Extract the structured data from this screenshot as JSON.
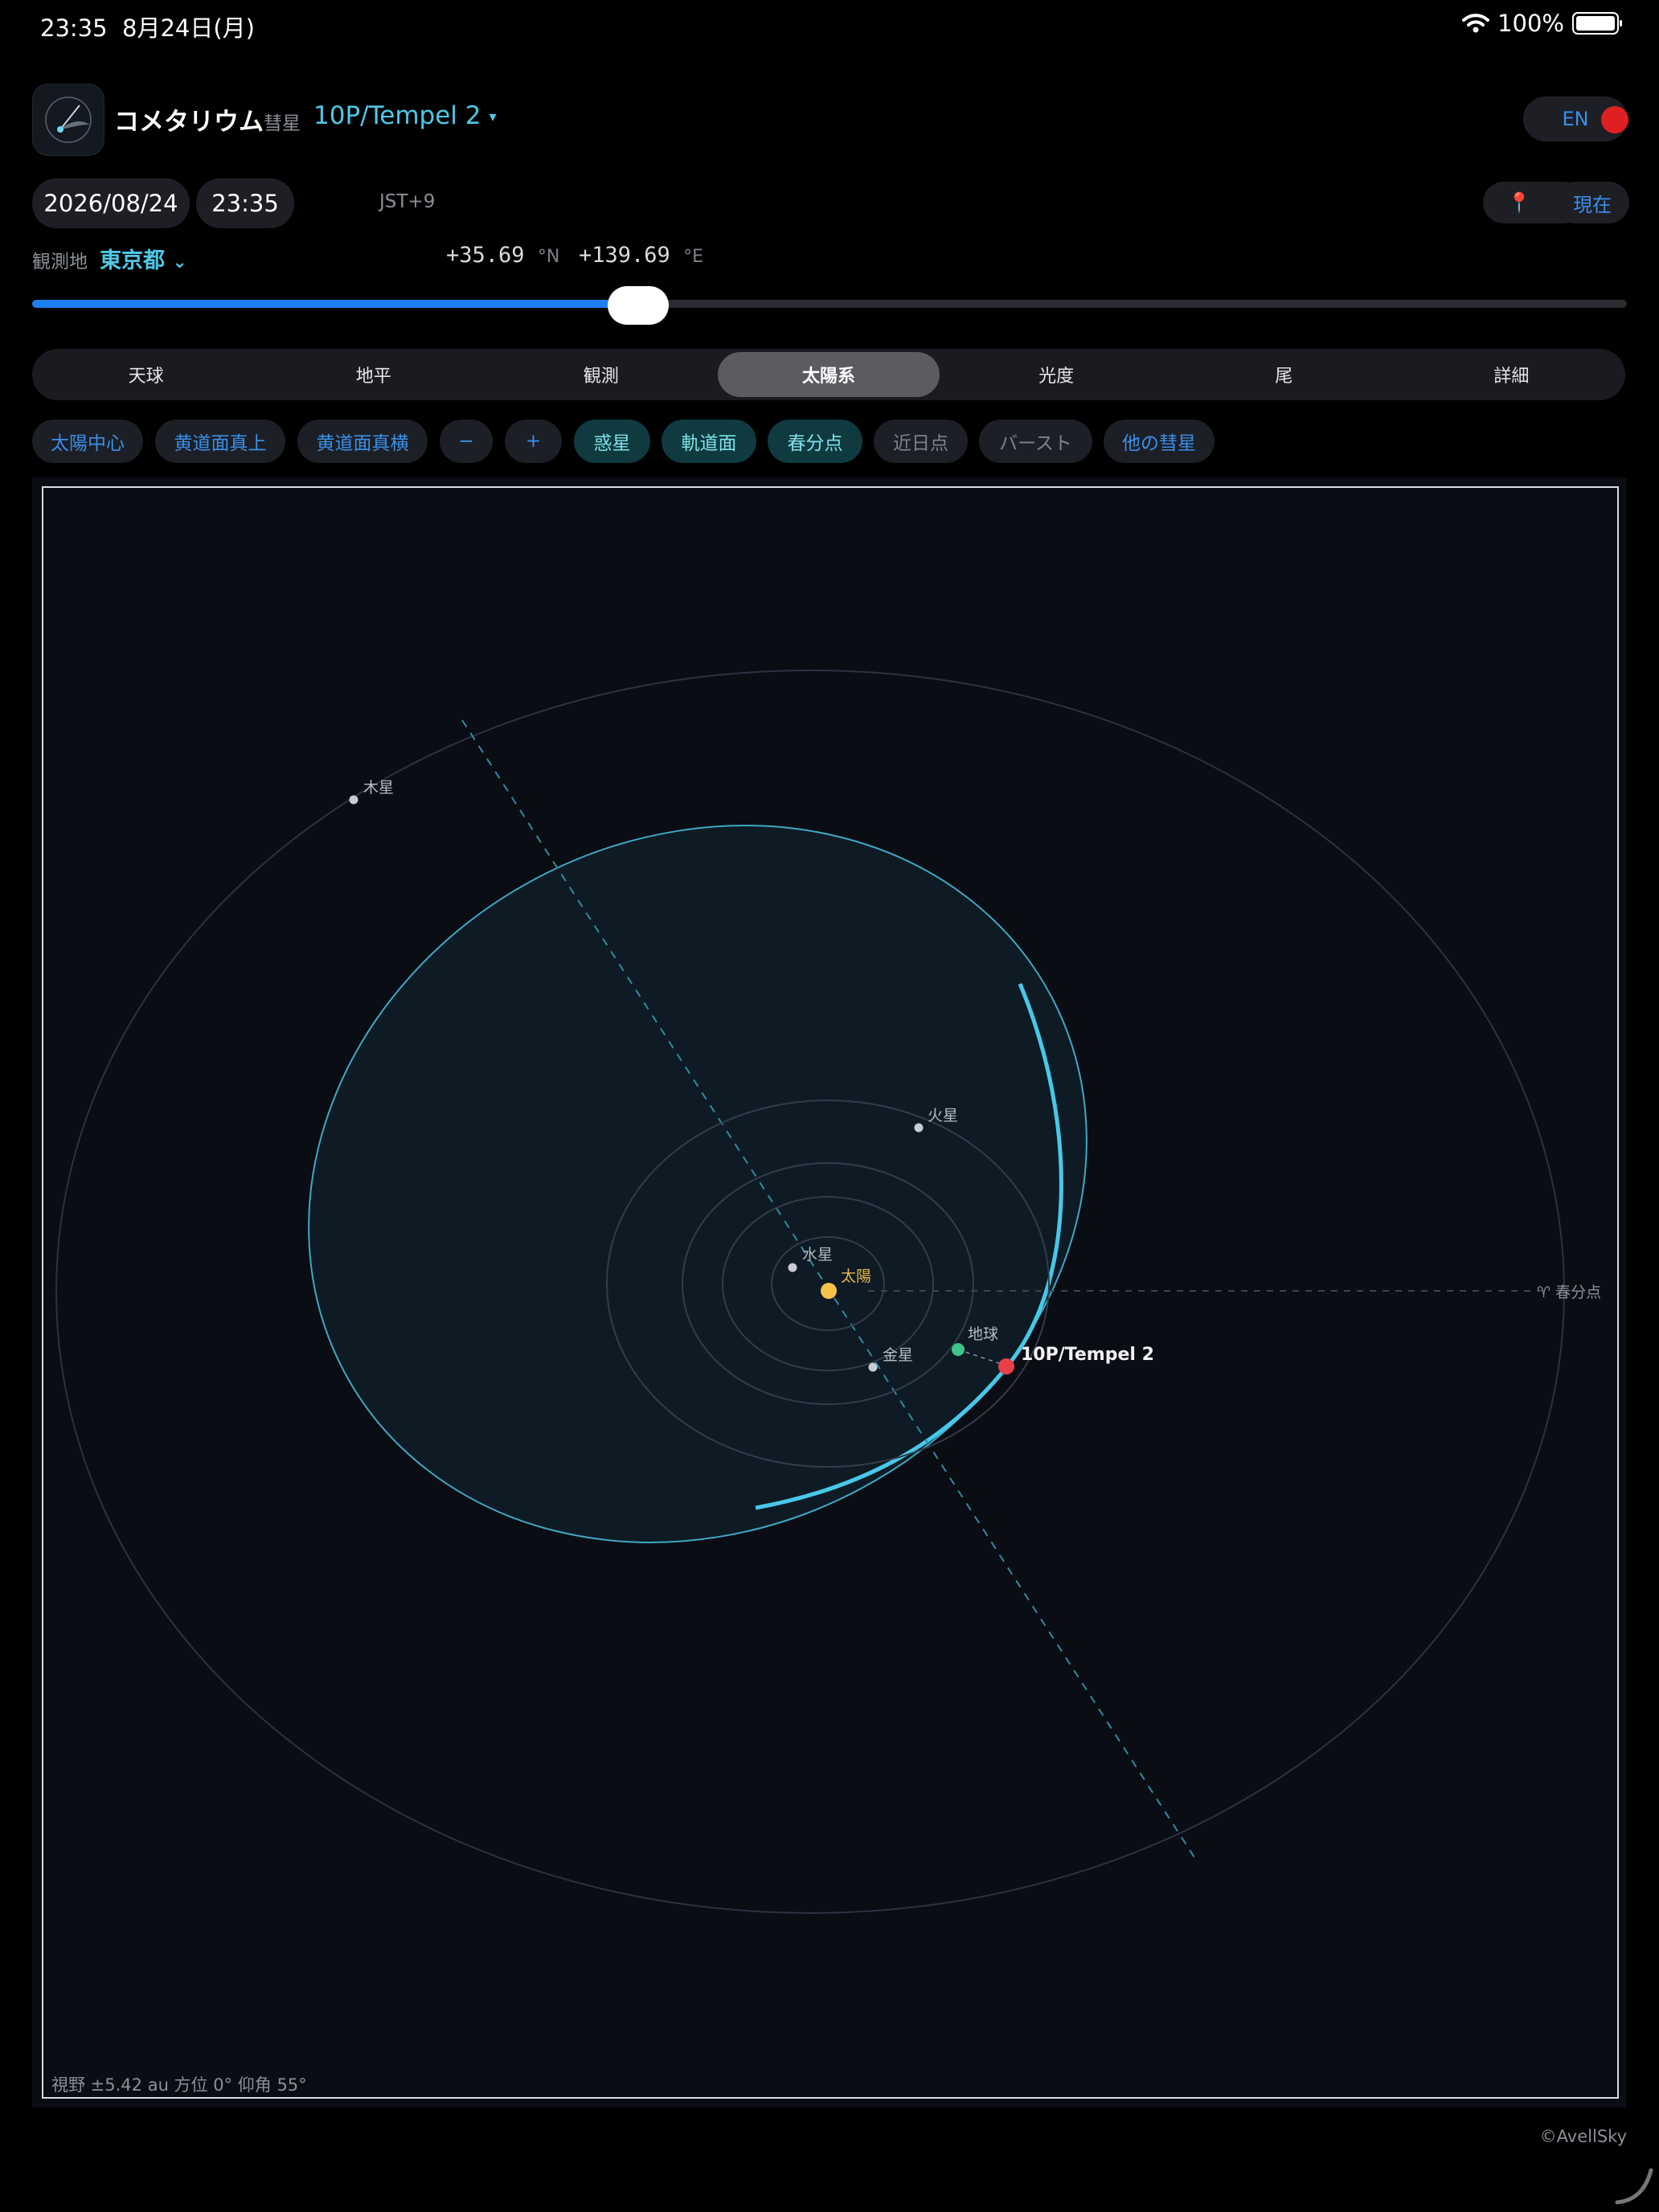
{
  "status": {
    "time": "23:35",
    "date": "8月24日(月)",
    "battery": "100%"
  },
  "header": {
    "app_name": "コメタリウム",
    "comet_label": "彗星",
    "comet_name": "10P/Tempel 2",
    "caret": "▾",
    "lang_button": "EN"
  },
  "datetime": {
    "date": "2026/08/24",
    "time": "23:35",
    "timezone": "JST+9",
    "pin_icon": "📍",
    "now_button": "現在"
  },
  "location": {
    "label": "観測地",
    "city": "東京都",
    "city_caret": "⌄",
    "lat_value": "+35.69",
    "lat_unit": "°N",
    "lon_value": "+139.69",
    "lon_unit": "°E"
  },
  "slider": {
    "value": 0.38
  },
  "tabs": [
    "天球",
    "地平",
    "観測",
    "太陽系",
    "光度",
    "尾",
    "詳細"
  ],
  "active_tab": 3,
  "chips": [
    {
      "label": "太陽中心",
      "style": "blue"
    },
    {
      "label": "黄道面真上",
      "style": "blue"
    },
    {
      "label": "黄道面真横",
      "style": "blue"
    },
    {
      "label": "−",
      "style": "blue"
    },
    {
      "label": "+",
      "style": "blue"
    },
    {
      "label": "惑星",
      "style": "teal"
    },
    {
      "label": "軌道面",
      "style": "teal"
    },
    {
      "label": "春分点",
      "style": "teal"
    },
    {
      "label": "近日点",
      "style": "gray"
    },
    {
      "label": "バースト",
      "style": "gray"
    },
    {
      "label": "他の彗星",
      "style": "blue"
    }
  ],
  "plot": {
    "bodies": {
      "sun": "太陽",
      "mercury": "水星",
      "venus": "金星",
      "earth": "地球",
      "mars": "火星",
      "jupiter": "木星",
      "comet": "10P/Tempel 2",
      "vernal_equinox": "♈ 春分点"
    },
    "footer": "視野 ±5.42 au  方位 0°  仰角 55°",
    "colors": {
      "comet_orbit": "#47c8e8",
      "comet": "#e8404a",
      "sun": "#f5c24a",
      "earth": "#3fc48a",
      "planet": "#c8ccd6"
    }
  },
  "credit": "©AvellSky"
}
